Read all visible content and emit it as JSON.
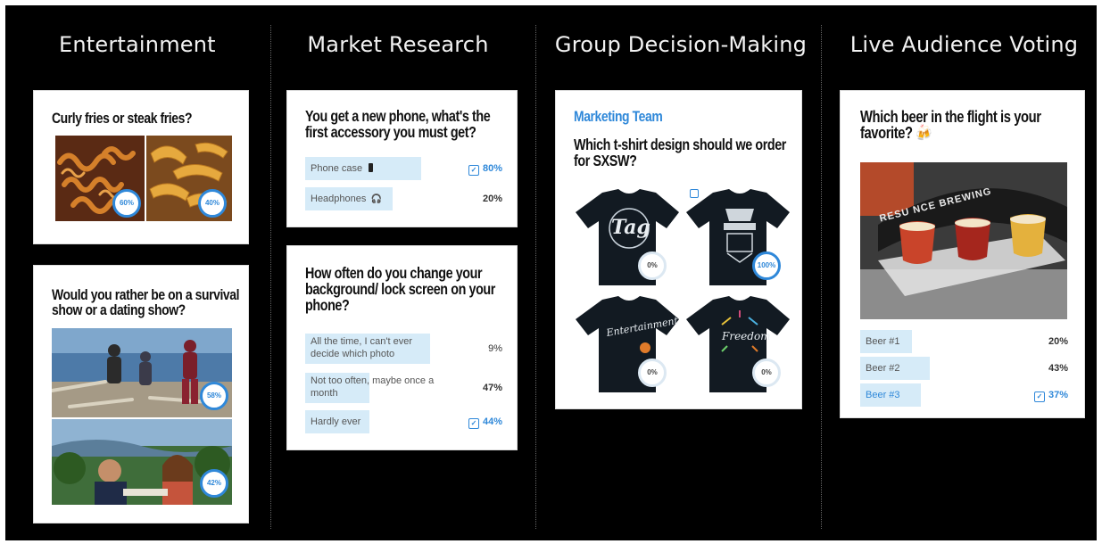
{
  "columns": [
    {
      "title": "Entertainment"
    },
    {
      "title": "Market Research"
    },
    {
      "title": "Group Decision-Making"
    },
    {
      "title": "Live Audience Voting"
    }
  ],
  "entertainment": {
    "fries": {
      "question": "Curly fries or steak fries?",
      "curly_pct": "60%",
      "steak_pct": "40%"
    },
    "show": {
      "question": "Would you rather be on a survival show or a dating show?",
      "survival_pct": "58%",
      "dating_pct": "42%"
    }
  },
  "market": {
    "phone": {
      "question": "You get a new phone, what's the first accessory you must get?",
      "options": [
        {
          "label": "Phone case",
          "pct": "80%"
        },
        {
          "label": "Headphones",
          "pct": "20%"
        }
      ]
    },
    "background": {
      "question": "How often do you change your background/ lock screen on your phone?",
      "options": [
        {
          "label": "All the time, I can't ever decide which photo",
          "pct": "9%"
        },
        {
          "label": "Not too often, maybe once a month",
          "pct": "47%"
        },
        {
          "label": "Hardly ever",
          "pct": "44%"
        }
      ]
    }
  },
  "group": {
    "team": "Marketing Team",
    "question": "Which t-shirt design should we order for SXSW?",
    "shirts": [
      {
        "text": "Tag",
        "pct": "0%"
      },
      {
        "text": "",
        "pct": "100%"
      },
      {
        "text": "Entertainment",
        "pct": "0%"
      },
      {
        "text": "Freedom",
        "pct": "0%"
      }
    ]
  },
  "live": {
    "question": "Which beer in the flight is your favorite?",
    "sign": "RESU  NCE BREWING",
    "options": [
      {
        "label": "Beer #1",
        "pct": "20%"
      },
      {
        "label": "Beer #2",
        "pct": "43%"
      },
      {
        "label": "Beer #3",
        "pct": "37%"
      }
    ]
  },
  "colors": {
    "accent": "#2f88d9",
    "option_bg": "#d6ebf8",
    "team": "#2f88d9"
  }
}
